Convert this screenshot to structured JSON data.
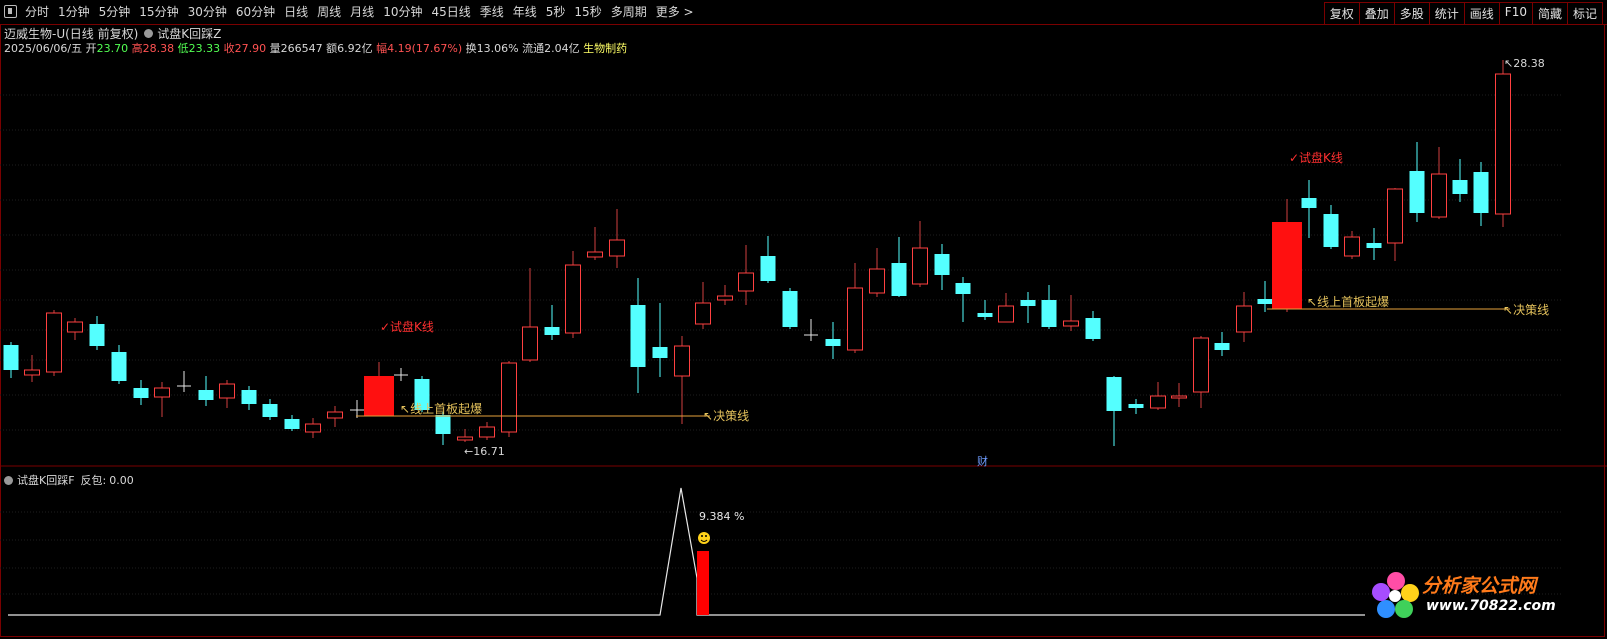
{
  "toolbar": {
    "periods": [
      "分时",
      "1分钟",
      "5分钟",
      "15分钟",
      "30分钟",
      "60分钟",
      "日线",
      "周线",
      "月线",
      "10分钟",
      "45日线",
      "季线",
      "年线",
      "5秒",
      "15秒",
      "多周期",
      "更多 >"
    ],
    "buttons": [
      "复权",
      "叠加",
      "多股",
      "统计",
      "画线",
      "F10",
      "简藏",
      "标记"
    ]
  },
  "header": {
    "stock_title": "迈威生物-U(日线 前复权)",
    "indicator_name": "试盘K回踩Z"
  },
  "quote": {
    "date": "2025/06/06/五",
    "open_label": "开",
    "open": "23.70",
    "high_label": "高",
    "high": "28.38",
    "low_label": "低",
    "low": "23.33",
    "close_label": "收",
    "close": "27.90",
    "volume_label": "量",
    "volume": "266547",
    "amount_label": "额",
    "amount": "6.92亿",
    "change_label": "幅",
    "change": "4.19(17.67%)",
    "turnover_label": "换",
    "turnover": "13.06%",
    "float_label": "流通",
    "float": "2.04亿",
    "sector": "生物制药"
  },
  "main_chart": {
    "price_high_label": "28.38",
    "price_low_label": "16.71",
    "annotations": {
      "trial_k_1": "✓试盘K线",
      "trial_k_2": "✓试盘K线",
      "first_board_1": "线上首板起爆",
      "first_board_2": "线上首板起爆",
      "decision_1": "决策线",
      "decision_2": "决策线",
      "finance_marker": "财"
    },
    "colors": {
      "up": "#ff4040",
      "down": "#54ffff",
      "signal": "#ff0000",
      "line": "#e6a23c",
      "text_signal": "#ff3030",
      "text_line": "#e6c35c"
    }
  },
  "sub_chart": {
    "title": "试盘K回踩F",
    "field_label": "反包:",
    "field_value": "0.00",
    "pct_label": "9.384 %"
  },
  "logo": {
    "cn": "分析家公式网",
    "url": "www.70822.com"
  }
}
